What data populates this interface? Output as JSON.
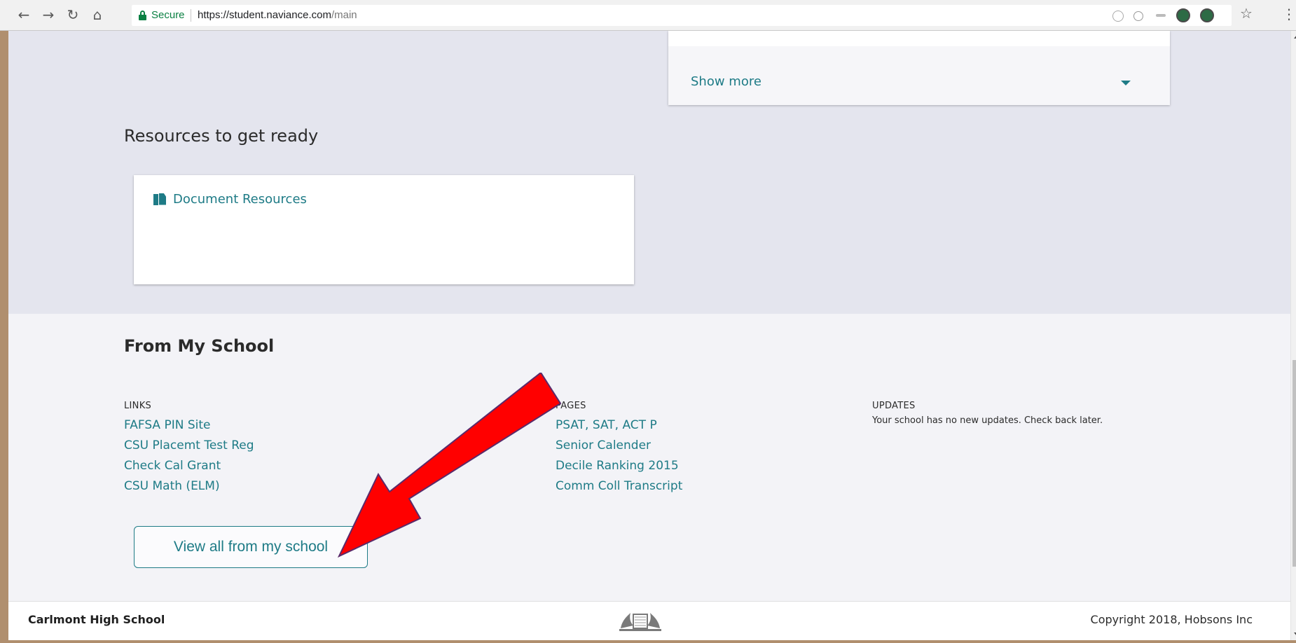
{
  "browser": {
    "secure_label": "Secure",
    "url_host": "https://student.naviance.com",
    "url_path": "/main",
    "icons": [
      "back-icon",
      "forward-icon",
      "reload-icon",
      "home-icon",
      "star-icon",
      "menu-icon"
    ]
  },
  "top_card": {
    "show_more_label": "Show more"
  },
  "resources": {
    "heading": "Resources to get ready",
    "items": [
      {
        "label": "Document Resources",
        "icon": "document-icon"
      }
    ]
  },
  "from_school": {
    "heading": "From My School",
    "links": {
      "title": "LINKS",
      "items": [
        "FAFSA PIN Site",
        "CSU Placemt Test Reg",
        "Check Cal Grant",
        "CSU Math (ELM)"
      ]
    },
    "pages": {
      "title": "PAGES",
      "items": [
        "PSAT, SAT, ACT P",
        "Senior Calender",
        "Decile Ranking 2015",
        "Comm Coll Transcript"
      ]
    },
    "updates": {
      "title": "UPDATES",
      "text": "Your school has no new updates. Check back later."
    },
    "view_all_label": "View all from my school"
  },
  "footer": {
    "school_name": "Carlmont High School",
    "copyright": "Copyright 2018, Hobsons Inc"
  },
  "colors": {
    "accent": "#1e7b86",
    "annotation_arrow": "#ff0000"
  }
}
